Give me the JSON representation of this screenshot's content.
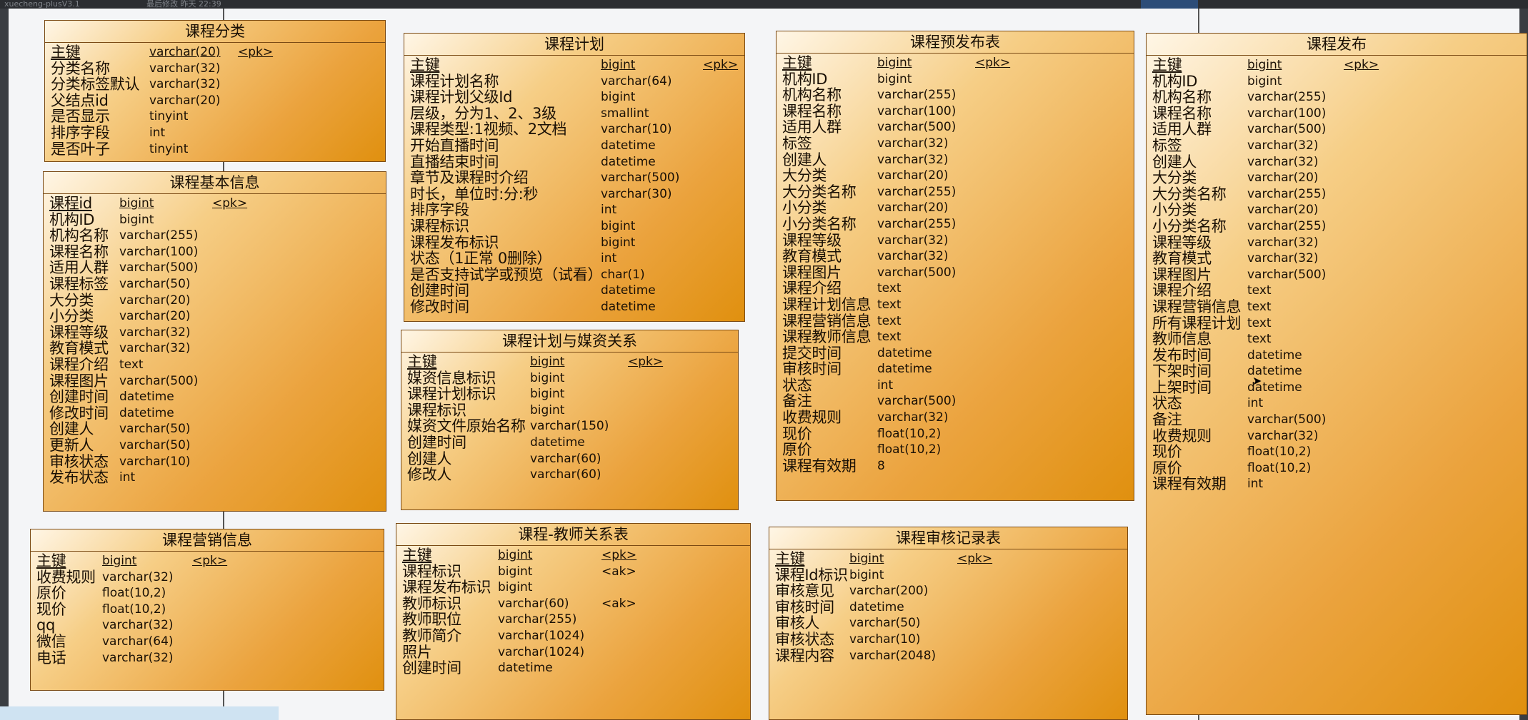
{
  "topbar": {
    "left_text": "xuecheng-plusV3.1",
    "mid_text": "最后修改 昨天 22:39"
  },
  "entities": [
    {
      "id": "kecheng-fenlei",
      "title": "课程分类",
      "columns": [
        {
          "field": "主键",
          "type": "varchar(20)",
          "key": "<pk>"
        },
        {
          "field": "分类名称",
          "type": "varchar(32)",
          "key": ""
        },
        {
          "field": "分类标签默认",
          "type": "varchar(32)",
          "key": ""
        },
        {
          "field": "父结点id",
          "type": "varchar(20)",
          "key": ""
        },
        {
          "field": "是否显示",
          "type": "tinyint",
          "key": ""
        },
        {
          "field": "排序字段",
          "type": "int",
          "key": ""
        },
        {
          "field": "是否叶子",
          "type": "tinyint",
          "key": ""
        }
      ]
    },
    {
      "id": "kecheng-jiben",
      "title": "课程基本信息",
      "columns": [
        {
          "field": "课程id",
          "type": "bigint",
          "key": "<pk>"
        },
        {
          "field": "机构ID",
          "type": "bigint",
          "key": ""
        },
        {
          "field": "机构名称",
          "type": "varchar(255)",
          "key": ""
        },
        {
          "field": "课程名称",
          "type": "varchar(100)",
          "key": ""
        },
        {
          "field": "适用人群",
          "type": "varchar(500)",
          "key": ""
        },
        {
          "field": "课程标签",
          "type": "varchar(50)",
          "key": ""
        },
        {
          "field": "大分类",
          "type": "varchar(20)",
          "key": ""
        },
        {
          "field": "小分类",
          "type": "varchar(20)",
          "key": ""
        },
        {
          "field": "课程等级",
          "type": "varchar(32)",
          "key": ""
        },
        {
          "field": "教育模式",
          "type": "varchar(32)",
          "key": ""
        },
        {
          "field": "课程介绍",
          "type": "text",
          "key": ""
        },
        {
          "field": "课程图片",
          "type": "varchar(500)",
          "key": ""
        },
        {
          "field": "创建时间",
          "type": "datetime",
          "key": ""
        },
        {
          "field": "修改时间",
          "type": "datetime",
          "key": ""
        },
        {
          "field": "创建人",
          "type": "varchar(50)",
          "key": ""
        },
        {
          "field": "更新人",
          "type": "varchar(50)",
          "key": ""
        },
        {
          "field": "审核状态",
          "type": "varchar(10)",
          "key": ""
        },
        {
          "field": "发布状态",
          "type": "int",
          "key": ""
        }
      ]
    },
    {
      "id": "kecheng-yingxiao",
      "title": "课程营销信息",
      "columns": [
        {
          "field": "主键",
          "type": "bigint",
          "key": "<pk>"
        },
        {
          "field": "收费规则",
          "type": "varchar(32)",
          "key": ""
        },
        {
          "field": "原价",
          "type": "float(10,2)",
          "key": ""
        },
        {
          "field": "现价",
          "type": "float(10,2)",
          "key": ""
        },
        {
          "field": "qq",
          "type": "varchar(32)",
          "key": ""
        },
        {
          "field": "微信",
          "type": "varchar(64)",
          "key": ""
        },
        {
          "field": "电话",
          "type": "varchar(32)",
          "key": ""
        }
      ]
    },
    {
      "id": "kecheng-jihua",
      "title": "课程计划",
      "columns": [
        {
          "field": "主键",
          "type": "bigint",
          "key": "<pk>"
        },
        {
          "field": "课程计划名称",
          "type": "varchar(64)",
          "key": ""
        },
        {
          "field": "课程计划父级Id",
          "type": "bigint",
          "key": ""
        },
        {
          "field": "层级，分为1、2、3级",
          "type": "smallint",
          "key": ""
        },
        {
          "field": "课程类型:1视频、2文档",
          "type": "varchar(10)",
          "key": ""
        },
        {
          "field": "开始直播时间",
          "type": "datetime",
          "key": ""
        },
        {
          "field": "直播结束时间",
          "type": "datetime",
          "key": ""
        },
        {
          "field": "章节及课程时介绍",
          "type": "varchar(500)",
          "key": ""
        },
        {
          "field": "时长，单位时:分:秒",
          "type": "varchar(30)",
          "key": ""
        },
        {
          "field": "排序字段",
          "type": "int",
          "key": ""
        },
        {
          "field": "课程标识",
          "type": "bigint",
          "key": ""
        },
        {
          "field": "课程发布标识",
          "type": "bigint",
          "key": ""
        },
        {
          "field": "状态（1正常  0删除）",
          "type": "int",
          "key": ""
        },
        {
          "field": "是否支持试学或预览（试看）",
          "type": "char(1)",
          "key": ""
        },
        {
          "field": "创建时间",
          "type": "datetime",
          "key": ""
        },
        {
          "field": "修改时间",
          "type": "datetime",
          "key": ""
        }
      ]
    },
    {
      "id": "jihua-meizi",
      "title": "课程计划与媒资关系",
      "columns": [
        {
          "field": "主键",
          "type": "bigint",
          "key": "<pk>"
        },
        {
          "field": "媒资信息标识",
          "type": "bigint",
          "key": ""
        },
        {
          "field": "课程计划标识",
          "type": "bigint",
          "key": ""
        },
        {
          "field": "课程标识",
          "type": "bigint",
          "key": ""
        },
        {
          "field": "媒资文件原始名称",
          "type": "varchar(150)",
          "key": ""
        },
        {
          "field": "创建时间",
          "type": "datetime",
          "key": ""
        },
        {
          "field": "创建人",
          "type": "varchar(60)",
          "key": ""
        },
        {
          "field": "修改人",
          "type": "varchar(60)",
          "key": ""
        }
      ]
    },
    {
      "id": "kecheng-jiaoshi",
      "title": "课程-教师关系表",
      "columns": [
        {
          "field": "主键",
          "type": "bigint",
          "key": "<pk>"
        },
        {
          "field": "课程标识",
          "type": "bigint",
          "key": "<ak>"
        },
        {
          "field": "课程发布标识",
          "type": "bigint",
          "key": ""
        },
        {
          "field": "教师标识",
          "type": "varchar(60)",
          "key": "<ak>"
        },
        {
          "field": "教师职位",
          "type": "varchar(255)",
          "key": ""
        },
        {
          "field": "教师简介",
          "type": "varchar(1024)",
          "key": ""
        },
        {
          "field": "照片",
          "type": "varchar(1024)",
          "key": ""
        },
        {
          "field": "创建时间",
          "type": "datetime",
          "key": ""
        }
      ]
    },
    {
      "id": "kecheng-yufabu",
      "title": "课程预发布表",
      "columns": [
        {
          "field": "主键",
          "type": "bigint",
          "key": "<pk>"
        },
        {
          "field": "机构ID",
          "type": "bigint",
          "key": ""
        },
        {
          "field": "机构名称",
          "type": "varchar(255)",
          "key": ""
        },
        {
          "field": "课程名称",
          "type": "varchar(100)",
          "key": ""
        },
        {
          "field": "适用人群",
          "type": "varchar(500)",
          "key": ""
        },
        {
          "field": "标签",
          "type": "varchar(32)",
          "key": ""
        },
        {
          "field": "创建人",
          "type": "varchar(32)",
          "key": ""
        },
        {
          "field": "大分类",
          "type": "varchar(20)",
          "key": ""
        },
        {
          "field": "大分类名称",
          "type": "varchar(255)",
          "key": ""
        },
        {
          "field": "小分类",
          "type": "varchar(20)",
          "key": ""
        },
        {
          "field": "小分类名称",
          "type": "varchar(255)",
          "key": ""
        },
        {
          "field": "课程等级",
          "type": "varchar(32)",
          "key": ""
        },
        {
          "field": "教育模式",
          "type": "varchar(32)",
          "key": ""
        },
        {
          "field": "课程图片",
          "type": "varchar(500)",
          "key": ""
        },
        {
          "field": "课程介绍",
          "type": "text",
          "key": ""
        },
        {
          "field": "课程计划信息",
          "type": "text",
          "key": ""
        },
        {
          "field": "课程营销信息",
          "type": "text",
          "key": ""
        },
        {
          "field": "课程教师信息",
          "type": "text",
          "key": ""
        },
        {
          "field": "提交时间",
          "type": "datetime",
          "key": ""
        },
        {
          "field": "审核时间",
          "type": "datetime",
          "key": ""
        },
        {
          "field": "状态",
          "type": "int",
          "key": ""
        },
        {
          "field": "备注",
          "type": "varchar(500)",
          "key": ""
        },
        {
          "field": "收费规则",
          "type": "varchar(32)",
          "key": ""
        },
        {
          "field": "现价",
          "type": "float(10,2)",
          "key": ""
        },
        {
          "field": "原价",
          "type": "float(10,2)",
          "key": ""
        },
        {
          "field": "课程有效期",
          "type": "8",
          "key": ""
        }
      ]
    },
    {
      "id": "kecheng-shenhe",
      "title": "课程审核记录表",
      "columns": [
        {
          "field": "主键",
          "type": "bigint",
          "key": "<pk>"
        },
        {
          "field": "课程Id标识",
          "type": "bigint",
          "key": ""
        },
        {
          "field": "审核意见",
          "type": "varchar(200)",
          "key": ""
        },
        {
          "field": "审核时间",
          "type": "datetime",
          "key": ""
        },
        {
          "field": "审核人",
          "type": "varchar(50)",
          "key": ""
        },
        {
          "field": "审核状态",
          "type": "varchar(10)",
          "key": ""
        },
        {
          "field": "课程内容",
          "type": "varchar(2048)",
          "key": ""
        }
      ]
    },
    {
      "id": "kecheng-fabu",
      "title": "课程发布",
      "columns": [
        {
          "field": "主键",
          "type": "bigint",
          "key": "<pk>"
        },
        {
          "field": "机构ID",
          "type": "bigint",
          "key": ""
        },
        {
          "field": "机构名称",
          "type": "varchar(255)",
          "key": ""
        },
        {
          "field": "课程名称",
          "type": "varchar(100)",
          "key": ""
        },
        {
          "field": "适用人群",
          "type": "varchar(500)",
          "key": ""
        },
        {
          "field": "标签",
          "type": "varchar(32)",
          "key": ""
        },
        {
          "field": "创建人",
          "type": "varchar(32)",
          "key": ""
        },
        {
          "field": "大分类",
          "type": "varchar(20)",
          "key": ""
        },
        {
          "field": "大分类名称",
          "type": "varchar(255)",
          "key": ""
        },
        {
          "field": "小分类",
          "type": "varchar(20)",
          "key": ""
        },
        {
          "field": "小分类名称",
          "type": "varchar(255)",
          "key": ""
        },
        {
          "field": "课程等级",
          "type": "varchar(32)",
          "key": ""
        },
        {
          "field": "教育模式",
          "type": "varchar(32)",
          "key": ""
        },
        {
          "field": "课程图片",
          "type": "varchar(500)",
          "key": ""
        },
        {
          "field": "课程介绍",
          "type": "text",
          "key": ""
        },
        {
          "field": "课程营销信息",
          "type": "text",
          "key": ""
        },
        {
          "field": "所有课程计划",
          "type": "text",
          "key": ""
        },
        {
          "field": "教师信息",
          "type": "text",
          "key": ""
        },
        {
          "field": "发布时间",
          "type": "datetime",
          "key": ""
        },
        {
          "field": "下架时间",
          "type": "datetime",
          "key": ""
        },
        {
          "field": "上架时间",
          "type": "datetime",
          "key": ""
        },
        {
          "field": "状态",
          "type": "int",
          "key": ""
        },
        {
          "field": "备注",
          "type": "varchar(500)",
          "key": ""
        },
        {
          "field": "收费规则",
          "type": "varchar(32)",
          "key": ""
        },
        {
          "field": "现价",
          "type": "float(10,2)",
          "key": ""
        },
        {
          "field": "原价",
          "type": "float(10,2)",
          "key": ""
        },
        {
          "field": "课程有效期",
          "type": "int",
          "key": ""
        }
      ]
    }
  ]
}
